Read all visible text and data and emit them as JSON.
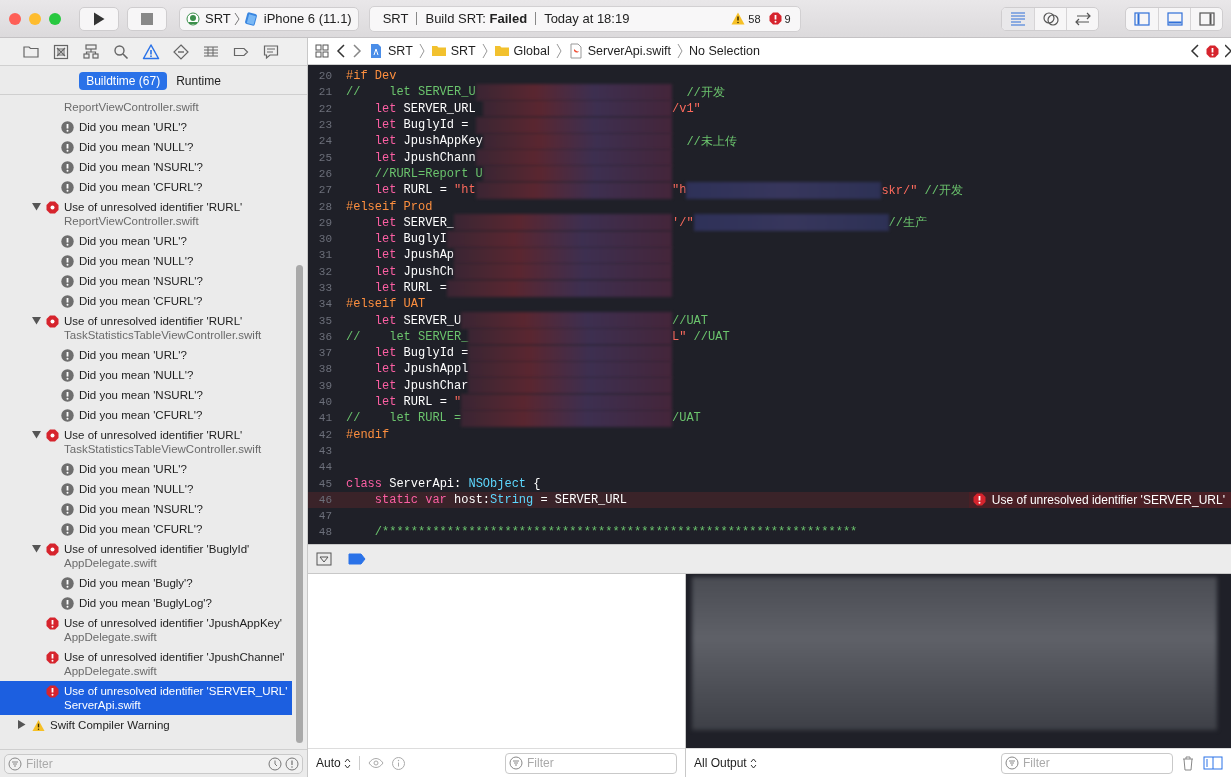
{
  "toolbar": {
    "window_controls": [
      {
        "kind": "close"
      },
      {
        "kind": "minimize"
      },
      {
        "kind": "zoom"
      }
    ],
    "scheme": {
      "target": "SRT",
      "device": "iPhone 6 (11.1)"
    },
    "activity": {
      "project": "SRT",
      "status": "Build SRT: **Failed**",
      "time": "Today at 18:19",
      "warnings": "58",
      "errors": "9"
    },
    "editor_modes": [
      {
        "kind": "standard",
        "selected": true
      },
      {
        "kind": "assistant",
        "selected": false
      },
      {
        "kind": "version",
        "selected": false
      }
    ],
    "panels": [
      {
        "kind": "navigator",
        "on": true
      },
      {
        "kind": "debug",
        "on": true
      },
      {
        "kind": "inspector",
        "on": false
      }
    ]
  },
  "navigator": {
    "tabs": [
      {
        "kind": "folder",
        "selected": false
      },
      {
        "kind": "source-control",
        "selected": false
      },
      {
        "kind": "hierarchy",
        "selected": false
      },
      {
        "kind": "search",
        "selected": false
      },
      {
        "kind": "warning",
        "selected": true
      },
      {
        "kind": "test",
        "selected": false
      },
      {
        "kind": "debug",
        "selected": false
      },
      {
        "kind": "breakpoint",
        "selected": false
      },
      {
        "kind": "report",
        "selected": false
      }
    ],
    "segments": [
      {
        "label": "Buildtime (67)",
        "selected": true
      },
      {
        "label": "Runtime",
        "selected": false
      }
    ],
    "issues": [
      {
        "kind": "error-category",
        "children": [
          {
            "kind": "continued",
            "file": "ReportViewController.swift",
            "children": [
              {
                "kind": "suggestion",
                "text": "Did you mean 'URL'?",
                "selected": false
              },
              {
                "kind": "suggestion",
                "text": "Did you mean 'NULL'?",
                "selected": false
              },
              {
                "kind": "suggestion",
                "text": "Did you mean 'NSURL'?",
                "selected": false
              },
              {
                "kind": "suggestion",
                "text": "Did you mean 'CFURL'?",
                "selected": false
              }
            ]
          },
          {
            "kind": "error-group",
            "title": "Use of unresolved identifier 'RURL'",
            "file": "ReportViewController.swift",
            "expanded": true,
            "selected": false,
            "children": [
              {
                "kind": "suggestion",
                "text": "Did you mean 'URL'?",
                "selected": false
              },
              {
                "kind": "suggestion",
                "text": "Did you mean 'NULL'?",
                "selected": false
              },
              {
                "kind": "suggestion",
                "text": "Did you mean 'NSURL'?",
                "selected": false
              },
              {
                "kind": "suggestion",
                "text": "Did you mean 'CFURL'?",
                "selected": false
              }
            ]
          },
          {
            "kind": "error-group",
            "title": "Use of unresolved identifier 'RURL'",
            "file": "TaskStatisticsTableViewController.swift",
            "expanded": true,
            "selected": false,
            "children": [
              {
                "kind": "suggestion",
                "text": "Did you mean 'URL'?",
                "selected": false
              },
              {
                "kind": "suggestion",
                "text": "Did you mean 'NULL'?",
                "selected": false
              },
              {
                "kind": "suggestion",
                "text": "Did you mean 'NSURL'?",
                "selected": false
              },
              {
                "kind": "suggestion",
                "text": "Did you mean 'CFURL'?",
                "selected": false
              }
            ]
          },
          {
            "kind": "error-group",
            "title": "Use of unresolved identifier 'RURL'",
            "file": "TaskStatisticsTableViewController.swift",
            "expanded": true,
            "selected": false,
            "children": [
              {
                "kind": "suggestion",
                "text": "Did you mean 'URL'?",
                "selected": false
              },
              {
                "kind": "suggestion",
                "text": "Did you mean 'NULL'?",
                "selected": false
              },
              {
                "kind": "suggestion",
                "text": "Did you mean 'NSURL'?",
                "selected": false
              },
              {
                "kind": "suggestion",
                "text": "Did you mean 'CFURL'?",
                "selected": false
              }
            ]
          },
          {
            "kind": "error-group",
            "title": "Use of unresolved identifier 'BuglyId'",
            "file": "AppDelegate.swift",
            "expanded": true,
            "selected": false,
            "children": [
              {
                "kind": "suggestion",
                "text": "Did you mean 'Bugly'?",
                "selected": false
              },
              {
                "kind": "suggestion",
                "text": "Did you mean 'BuglyLog'?",
                "selected": false
              }
            ]
          },
          {
            "kind": "error",
            "title": "Use of unresolved identifier 'JpushAppKey'",
            "file": "AppDelegate.swift",
            "selected": false
          },
          {
            "kind": "error",
            "title": "Use of unresolved identifier 'JpushChannel'",
            "file": "AppDelegate.swift",
            "selected": false
          },
          {
            "kind": "error",
            "title": "Use of unresolved identifier 'SERVER_URL'",
            "file": "ServerApi.swift",
            "selected": true
          }
        ]
      },
      {
        "kind": "warning-category",
        "title": "Swift Compiler Warning",
        "expanded": false,
        "selected": false
      }
    ],
    "filter": {
      "placeholder": "Filter"
    }
  },
  "jump_bar": {
    "items": [
      {
        "kind": "project",
        "label": "SRT"
      },
      {
        "kind": "folder",
        "label": "SRT"
      },
      {
        "kind": "folder",
        "label": "Global"
      },
      {
        "kind": "swift-file",
        "label": "ServerApi.swift"
      },
      {
        "kind": "plain",
        "label": "No Selection"
      }
    ]
  },
  "editor": {
    "lines": [
      {
        "number": "20",
        "tokens": [
          {
            "kind": "directive",
            "text": "#if Dev"
          }
        ]
      },
      {
        "number": "21",
        "tokens": [
          {
            "kind": "comment",
            "text": "//    let SERVER_U"
          }
        ],
        "redacted": true,
        "tail": [
          {
            "kind": "comment",
            "text": "  //开发"
          }
        ]
      },
      {
        "number": "22",
        "tokens": [
          {
            "kind": "keyword",
            "text": "    let"
          },
          {
            "kind": "plain",
            "text": " SERVER_URL "
          }
        ],
        "redacted": true,
        "tail": [
          {
            "kind": "string",
            "text": "/v1\""
          }
        ]
      },
      {
        "number": "23",
        "tokens": [
          {
            "kind": "keyword",
            "text": "    let"
          },
          {
            "kind": "plain",
            "text": " BuglyId = "
          }
        ],
        "redacted": true
      },
      {
        "number": "24",
        "tokens": [
          {
            "kind": "keyword",
            "text": "    let"
          },
          {
            "kind": "plain",
            "text": " JpushAppKey"
          }
        ],
        "redacted": true,
        "tail": [
          {
            "kind": "comment",
            "text": "  //未上传"
          }
        ]
      },
      {
        "number": "25",
        "tokens": [
          {
            "kind": "keyword",
            "text": "    let"
          },
          {
            "kind": "plain",
            "text": " JpushChann"
          }
        ],
        "redacted": true
      },
      {
        "number": "26",
        "tokens": [
          {
            "kind": "comment",
            "text": "    //RURL=Report U"
          }
        ],
        "redacted": true
      },
      {
        "number": "27",
        "tokens": [
          {
            "kind": "keyword",
            "text": "    let"
          },
          {
            "kind": "plain",
            "text": " RURL = "
          },
          {
            "kind": "string",
            "text": "\"ht"
          }
        ],
        "redacted": true,
        "tail": [
          {
            "kind": "string",
            "text": "\"h"
          },
          {
            "kind": "redacted"
          },
          {
            "kind": "string",
            "text": "skr/\""
          },
          {
            "kind": "comment",
            "text": " //开发"
          }
        ]
      },
      {
        "number": "28",
        "tokens": [
          {
            "kind": "directive",
            "text": "#elseif Prod"
          }
        ]
      },
      {
        "number": "29",
        "tokens": [
          {
            "kind": "keyword",
            "text": "    let"
          },
          {
            "kind": "plain",
            "text": " SERVER_"
          }
        ],
        "redacted": true,
        "tail": [
          {
            "kind": "string",
            "text": "'/\""
          },
          {
            "kind": "redacted"
          },
          {
            "kind": "comment",
            "text": "//生产"
          }
        ]
      },
      {
        "number": "30",
        "tokens": [
          {
            "kind": "keyword",
            "text": "    let"
          },
          {
            "kind": "plain",
            "text": " BuglyI"
          }
        ],
        "redacted": true
      },
      {
        "number": "31",
        "tokens": [
          {
            "kind": "keyword",
            "text": "    let"
          },
          {
            "kind": "plain",
            "text": " JpushAp"
          }
        ],
        "redacted": true
      },
      {
        "number": "32",
        "tokens": [
          {
            "kind": "keyword",
            "text": "    let"
          },
          {
            "kind": "plain",
            "text": " JpushCh"
          }
        ],
        "redacted": true
      },
      {
        "number": "33",
        "tokens": [
          {
            "kind": "keyword",
            "text": "    let"
          },
          {
            "kind": "plain",
            "text": " RURL ="
          }
        ],
        "redacted": true
      },
      {
        "number": "34",
        "tokens": [
          {
            "kind": "directive",
            "text": "#elseif UAT"
          }
        ]
      },
      {
        "number": "35",
        "tokens": [
          {
            "kind": "keyword",
            "text": "    let"
          },
          {
            "kind": "plain",
            "text": " SERVER_U"
          }
        ],
        "redacted": true,
        "tail": [
          {
            "kind": "comment",
            "text": "//UAT"
          }
        ]
      },
      {
        "number": "36",
        "tokens": [
          {
            "kind": "comment",
            "text": "//    let SERVER_"
          }
        ],
        "redacted": true,
        "tail": [
          {
            "kind": "string",
            "text": "L\""
          },
          {
            "kind": "comment",
            "text": " //UAT"
          }
        ]
      },
      {
        "number": "37",
        "tokens": [
          {
            "kind": "keyword",
            "text": "    let"
          },
          {
            "kind": "plain",
            "text": " BuglyId ="
          }
        ],
        "redacted": true
      },
      {
        "number": "38",
        "tokens": [
          {
            "kind": "keyword",
            "text": "    let"
          },
          {
            "kind": "plain",
            "text": " JpushAppl"
          }
        ],
        "redacted": true
      },
      {
        "number": "39",
        "tokens": [
          {
            "kind": "keyword",
            "text": "    let"
          },
          {
            "kind": "plain",
            "text": " JpushChar"
          }
        ],
        "redacted": true
      },
      {
        "number": "40",
        "tokens": [
          {
            "kind": "keyword",
            "text": "    let"
          },
          {
            "kind": "plain",
            "text": " RURL = "
          },
          {
            "kind": "string",
            "text": "\""
          }
        ],
        "redacted": true
      },
      {
        "number": "41",
        "tokens": [
          {
            "kind": "comment",
            "text": "//    let RURL ="
          }
        ],
        "redacted": true,
        "tail": [
          {
            "kind": "comment",
            "text": "/UAT"
          }
        ]
      },
      {
        "number": "42",
        "tokens": [
          {
            "kind": "directive",
            "text": "#endif"
          }
        ]
      },
      {
        "number": "43"
      },
      {
        "number": "44"
      },
      {
        "number": "45",
        "tokens": [
          {
            "kind": "keyword",
            "text": "class"
          },
          {
            "kind": "plain",
            "text": " ServerApi: "
          },
          {
            "kind": "type",
            "text": "NSObject"
          },
          {
            "kind": "plain",
            "text": " {"
          }
        ]
      },
      {
        "number": "46",
        "tokens": [
          {
            "kind": "keyword",
            "text": "    static var"
          },
          {
            "kind": "plain",
            "text": " host:"
          },
          {
            "kind": "type",
            "text": "String"
          },
          {
            "kind": "plain",
            "text": " = SERVER_URL"
          }
        ],
        "error": "Use of unresolved identifier 'SERVER_URL'"
      },
      {
        "number": "47"
      },
      {
        "number": "48",
        "tokens": [
          {
            "kind": "comment",
            "text": "    /******************************************************************"
          }
        ]
      }
    ]
  },
  "debug": {
    "breakpoints_active": true,
    "variables": {
      "scope": "Auto",
      "filter_placeholder": "Filter"
    },
    "console": {
      "output": "All Output",
      "filter_placeholder": "Filter"
    }
  }
}
